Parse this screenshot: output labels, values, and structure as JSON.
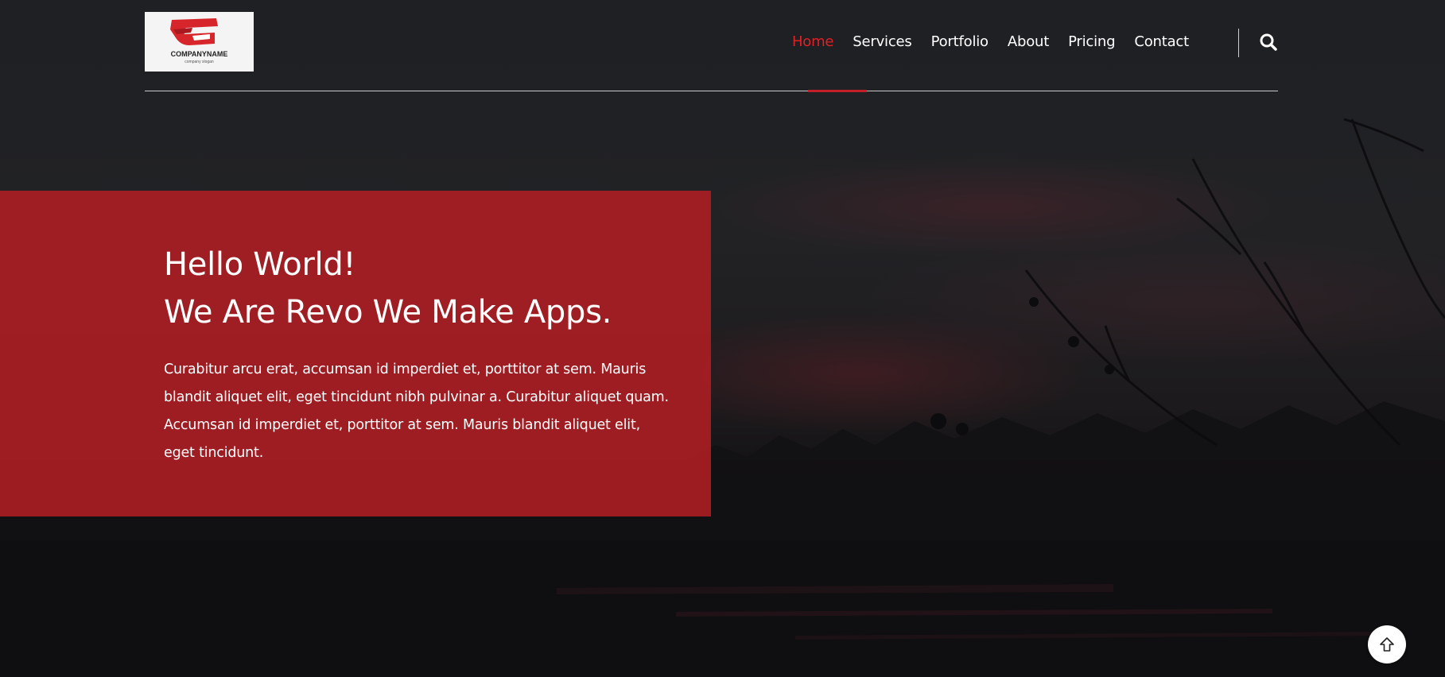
{
  "logo": {
    "company_name": "COMPANYNAME",
    "slogan": "company slogan",
    "brand_color": "#d7262b"
  },
  "nav": {
    "items": [
      {
        "label": "Home",
        "active": true
      },
      {
        "label": "Services",
        "active": false
      },
      {
        "label": "Portfolio",
        "active": false
      },
      {
        "label": "About",
        "active": false
      },
      {
        "label": "Pricing",
        "active": false
      },
      {
        "label": "Contact",
        "active": false
      }
    ],
    "search_icon": "search-icon"
  },
  "hero": {
    "title_line1": "Hello World!",
    "title_line2": "We Are Revo We Make Apps.",
    "body": "Curabitur arcu erat, accumsan id imperdiet et, porttitor at sem. Mauris blandit aliquet elit, eget tincidunt nibh pulvinar a. Curabitur aliquet quam. Accumsan id imperdiet et, porttitor at sem. Mauris blandit aliquet elit, eget tincidunt."
  },
  "scroll_top": {
    "icon": "arrow-up-icon"
  },
  "colors": {
    "accent": "#e02027",
    "hero_box": "#ac1e24",
    "background": "#1e2023"
  }
}
